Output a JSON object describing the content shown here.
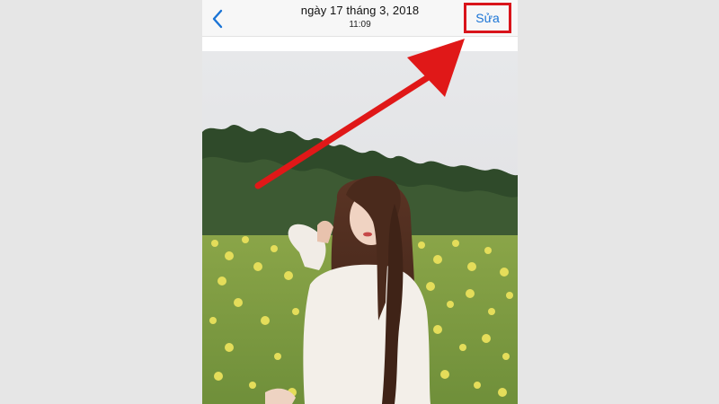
{
  "navbar": {
    "date_title": "ngày 17 tháng 3, 2018",
    "time_subtitle": "11:09",
    "back_icon": "chevron-left-icon",
    "edit_label": "Sửa"
  },
  "photo": {
    "subject": "photo"
  },
  "annotation": {
    "highlight_color": "#d9141b",
    "arrow_color": "#e01818"
  },
  "colors": {
    "accent": "#1a74d6",
    "background": "#e6e6e6"
  }
}
